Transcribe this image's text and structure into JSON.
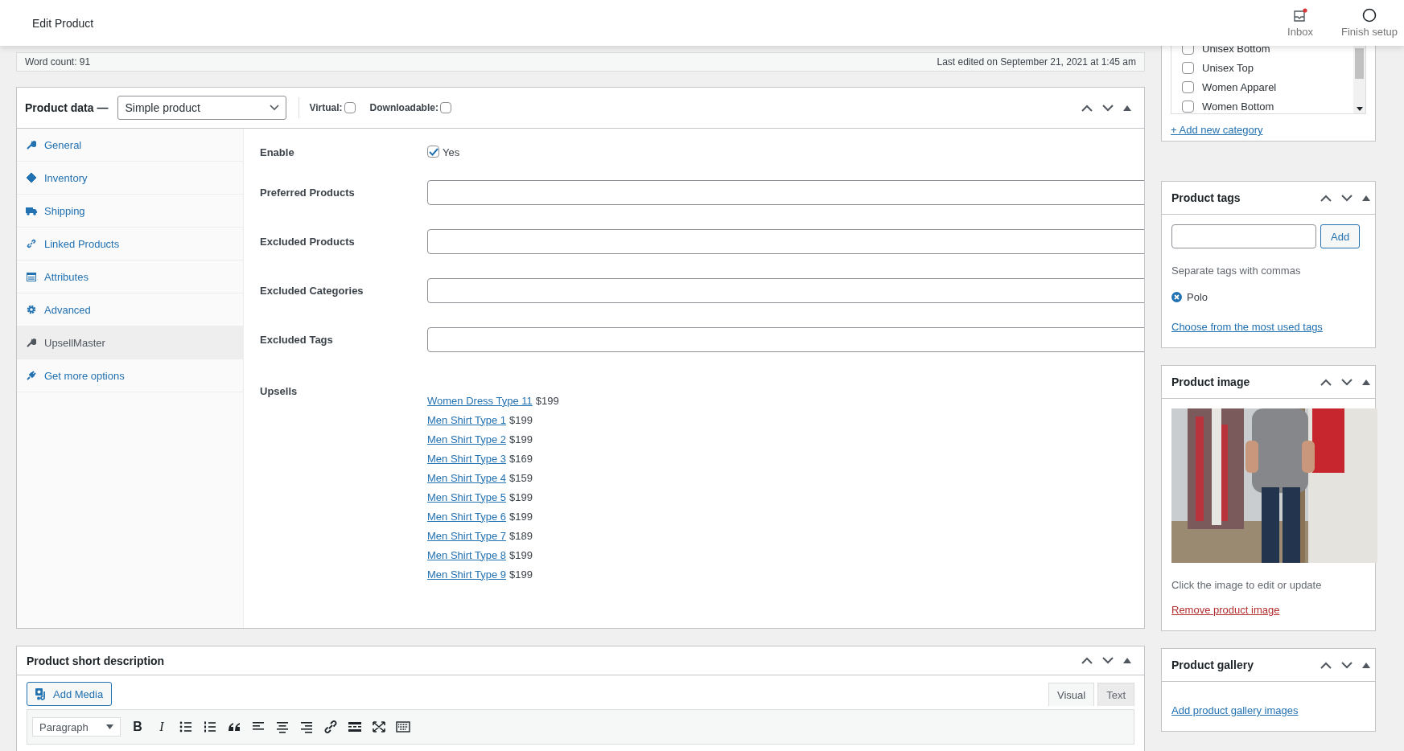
{
  "header": {
    "title": "Edit Product",
    "actions": [
      {
        "kind": "inbox",
        "label": "Inbox",
        "notification": true
      },
      {
        "kind": "setup",
        "label": "Finish setup",
        "notification": false
      }
    ]
  },
  "editor_status": {
    "word_count": "Word count: 91",
    "last_edited": "Last edited on September 21, 2021 at 1:45 am"
  },
  "product_data": {
    "title": "Product data —",
    "type": "Simple product",
    "virtual_label": "Virtual:",
    "virtual": false,
    "downloadable_label": "Downloadable:",
    "downloadable": false,
    "tabs": [
      {
        "kind": "wrench",
        "label": "General",
        "selected": false
      },
      {
        "kind": "tag",
        "label": "Inventory",
        "selected": false
      },
      {
        "kind": "truck",
        "label": "Shipping",
        "selected": false
      },
      {
        "kind": "link",
        "label": "Linked Products",
        "selected": false
      },
      {
        "kind": "table",
        "label": "Attributes",
        "selected": false
      },
      {
        "kind": "gear",
        "label": "Advanced",
        "selected": false
      },
      {
        "kind": "wrench",
        "label": "UpsellMaster",
        "selected": true
      },
      {
        "kind": "plug",
        "label": "Get more options",
        "selected": false
      }
    ],
    "fields": [
      {
        "kind": "checkbox",
        "label": "Enable",
        "checked": true,
        "option": "Yes"
      },
      {
        "kind": "text",
        "label": "Preferred Products"
      },
      {
        "kind": "text",
        "label": "Excluded Products"
      },
      {
        "kind": "text",
        "label": "Excluded Categories"
      },
      {
        "kind": "text",
        "label": "Excluded Tags"
      },
      {
        "kind": "links",
        "label": "Upsells",
        "items": [
          {
            "name": "Women Dress Type 11",
            "price": "$199"
          },
          {
            "name": "Men Shirt Type 1",
            "price": "$199"
          },
          {
            "name": "Men Shirt Type 2",
            "price": "$199"
          },
          {
            "name": "Men Shirt Type 3",
            "price": "$169"
          },
          {
            "name": "Men Shirt Type 4",
            "price": "$159"
          },
          {
            "name": "Men Shirt Type 5",
            "price": "$199"
          },
          {
            "name": "Men Shirt Type 6",
            "price": "$199"
          },
          {
            "name": "Men Shirt Type 7",
            "price": "$189"
          },
          {
            "name": "Men Shirt Type 8",
            "price": "$199"
          },
          {
            "name": "Men Shirt Type 9",
            "price": "$199"
          }
        ]
      }
    ]
  },
  "short_description": {
    "title": "Product short description",
    "add_media": "Add Media",
    "modes": [
      {
        "label": "Visual",
        "selected": true
      },
      {
        "label": "Text",
        "selected": false
      }
    ],
    "format": "Paragraph",
    "toolbar": [
      {
        "kind": "bold",
        "glyph": "B"
      },
      {
        "kind": "italic",
        "glyph": "I"
      },
      {
        "kind": "bullets"
      },
      {
        "kind": "numbers"
      },
      {
        "kind": "quote"
      },
      {
        "kind": "align-left"
      },
      {
        "kind": "align-center"
      },
      {
        "kind": "align-right"
      },
      {
        "kind": "link"
      },
      {
        "kind": "more"
      },
      {
        "kind": "fullscreen"
      },
      {
        "kind": "keyboard"
      }
    ]
  },
  "sidebar": {
    "categories": [
      {
        "label": "Unisex Bottom",
        "checked": false
      },
      {
        "label": "Unisex Top",
        "checked": false
      },
      {
        "label": "Women Apparel",
        "checked": false
      },
      {
        "label": "Women Bottom",
        "checked": false
      }
    ],
    "add_category": "+ Add new category",
    "tags": {
      "title": "Product tags",
      "button": "Add",
      "hint": "Separate tags with commas",
      "items": [
        "Polo"
      ],
      "link": "Choose from the most used tags"
    },
    "image": {
      "title": "Product image",
      "kind": "picture",
      "hint": "Click the image to edit or update",
      "remove": "Remove product image"
    },
    "gallery": {
      "title": "Product gallery",
      "link": "Add product gallery images"
    }
  }
}
